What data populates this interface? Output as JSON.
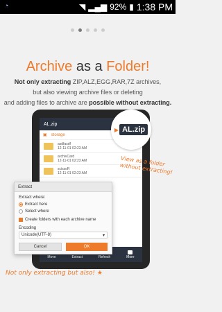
{
  "status_bar": {
    "battery_percent": "92%",
    "time": "1:38 PM"
  },
  "hero": {
    "headline_part1": "Archive",
    "headline_part2": " as a ",
    "headline_part3": "Folder!",
    "desc_line1_prefix": "Not only extracting ",
    "desc_line1_suffix": "ZIP,ALZ,EGG,RAR,7Z archives,",
    "desc_line2": "but also viewing archive files or deleting",
    "desc_line3_prefix": "and adding files to archive are ",
    "desc_line3_suffix": "possible without extracting."
  },
  "phone": {
    "app_title": "AL.zip",
    "path": "storage",
    "files": [
      {
        "name": "asdfasdf",
        "meta": "12-11-01 02:23 AM"
      },
      {
        "name": "archivCard",
        "meta": "12-11-01 02:23 AM"
      },
      {
        "name": "scissoR",
        "meta": "12-11-01 02:23 AM"
      }
    ],
    "bottom_bar": [
      "Move",
      "Extract",
      "Refresh",
      "More"
    ]
  },
  "dialog": {
    "title": "Extract",
    "extract_where_label": "Extract where:",
    "opt_extract_here": "Extract here",
    "opt_select_where": "Select where",
    "create_folders_label": "Create folders with each archive name",
    "encoding_label": "Encoding",
    "encoding_value": "Unicode(UTF-8)",
    "cancel": "Cancel",
    "ok": "OK"
  },
  "bubble": {
    "label": "AL.zip"
  },
  "callouts": {
    "right": "View as a folder without extracting!",
    "left": "Not only extracting but also! ★"
  },
  "colors": {
    "accent": "#ee7a2b",
    "dark": "#2c3340"
  }
}
